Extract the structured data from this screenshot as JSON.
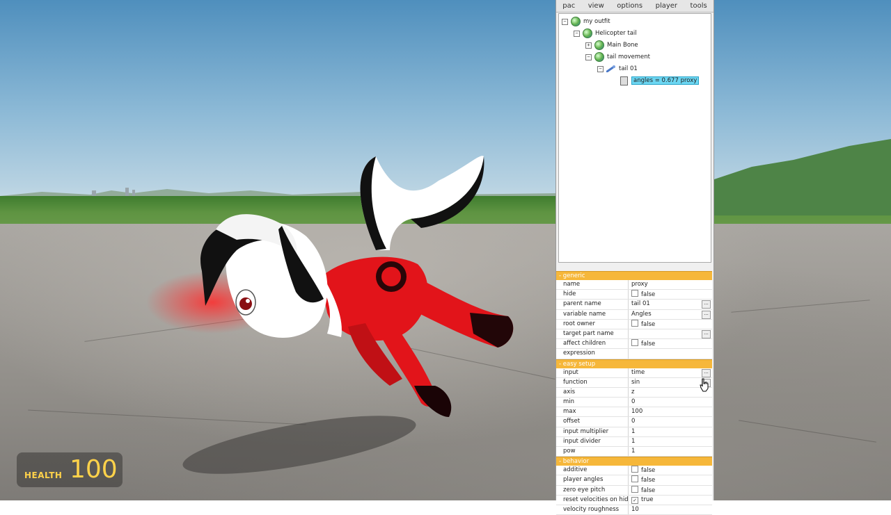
{
  "menu": [
    "pac",
    "view",
    "options",
    "player",
    "tools"
  ],
  "tree": {
    "root": "my outfit",
    "helicopter": "Helicopter tail",
    "main_bone": "Main Bone",
    "tail_movement": "tail movement",
    "tail01": "tail 01",
    "selected": "angles = 0.677 proxy",
    "expander_open": "−",
    "expander_closed": "+"
  },
  "categories": {
    "generic": "- generic",
    "easy_setup": "- easy setup",
    "behavior": "- behavior"
  },
  "props": {
    "name": {
      "k": "name",
      "v": "proxy"
    },
    "hide": {
      "k": "hide",
      "v": "false"
    },
    "parent_name": {
      "k": "parent name",
      "v": "tail 01"
    },
    "variable_name": {
      "k": "variable name",
      "v": "Angles"
    },
    "root_owner": {
      "k": "root owner",
      "v": "false"
    },
    "target_part_name": {
      "k": "target part name",
      "v": ""
    },
    "affect_children": {
      "k": "affect children",
      "v": "false"
    },
    "expression": {
      "k": "expression",
      "v": ""
    },
    "input": {
      "k": "input",
      "v": "time"
    },
    "function": {
      "k": "function",
      "v": "sin"
    },
    "axis": {
      "k": "axis",
      "v": "z"
    },
    "min": {
      "k": "min",
      "v": "0"
    },
    "max": {
      "k": "max",
      "v": "100"
    },
    "offset": {
      "k": "offset",
      "v": "0"
    },
    "input_multiplier": {
      "k": "input multiplier",
      "v": "1"
    },
    "input_divider": {
      "k": "input divider",
      "v": "1"
    },
    "pow": {
      "k": "pow",
      "v": "1"
    },
    "additive": {
      "k": "additive",
      "v": "false"
    },
    "player_angles": {
      "k": "player angles",
      "v": "false"
    },
    "zero_eye_pitch": {
      "k": "zero eye pitch",
      "v": "false"
    },
    "reset_velocities": {
      "k": "reset velocities on hide",
      "v": "true"
    },
    "velocity_roughness": {
      "k": "velocity roughness",
      "v": "10"
    }
  },
  "dots_label": "...",
  "check_mark": "✓",
  "hud": {
    "health_label": "HEALTH",
    "health_value": "100"
  },
  "colors": {
    "hud": "#ffd24a",
    "category": "#f6b73a",
    "selection": "#6cd6f2"
  }
}
